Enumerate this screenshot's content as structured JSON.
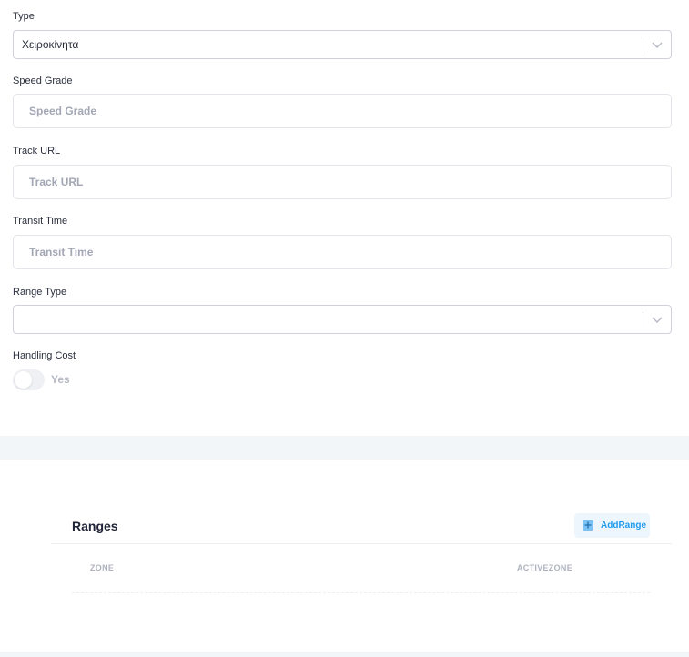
{
  "form": {
    "type": {
      "label": "Type",
      "value": "Χειροκίνητα"
    },
    "speed_grade": {
      "label": "Speed Grade",
      "placeholder": "Speed Grade",
      "value": ""
    },
    "track_url": {
      "label": "Track URL",
      "placeholder": "Track URL",
      "value": ""
    },
    "transit_time": {
      "label": "Transit Time",
      "placeholder": "Transit Time",
      "value": ""
    },
    "range_type": {
      "label": "Range Type",
      "value": ""
    },
    "handling_cost": {
      "label": "Handling Cost",
      "toggle_label": "Yes",
      "checked": false
    }
  },
  "ranges": {
    "title": "Ranges",
    "add_button_label": "AddRange",
    "columns": [
      "ZONE",
      "ACTIVEZONE"
    ],
    "rows": []
  },
  "icons": {
    "select_chevron": "chevron-down-icon",
    "add": "plus-square-icon"
  },
  "colors": {
    "accent": "#1f9bf0",
    "accent_light": "#eef6fd",
    "section_band": "#f3f6f9"
  }
}
